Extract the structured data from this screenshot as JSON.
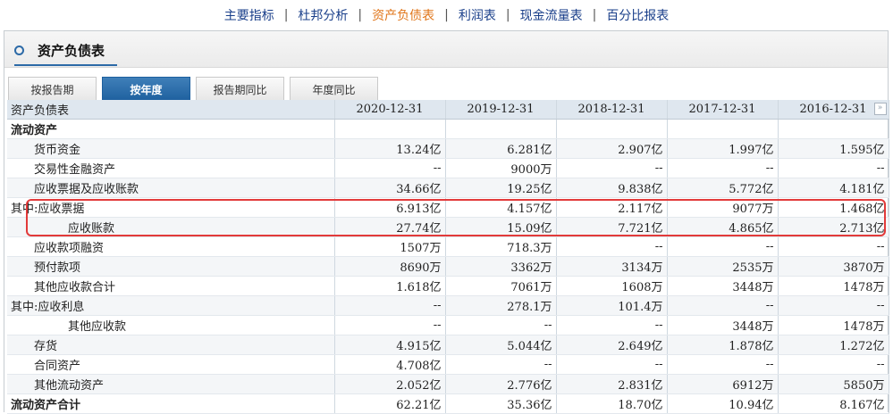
{
  "topnav": {
    "items": [
      {
        "label": "主要指标",
        "active": false
      },
      {
        "label": "杜邦分析",
        "active": false
      },
      {
        "label": "资产负债表",
        "active": true
      },
      {
        "label": "利润表",
        "active": false
      },
      {
        "label": "现金流量表",
        "active": false
      },
      {
        "label": "百分比报表",
        "active": false
      }
    ],
    "separator": "|",
    "active_color": "#e0761b",
    "link_color": "#1a3f8a"
  },
  "section": {
    "title": "资产负债表",
    "icon": "circle-icon"
  },
  "tabs": [
    {
      "label": "按报告期",
      "active": false
    },
    {
      "label": "按年度",
      "active": true
    },
    {
      "label": "报告期同比",
      "active": false
    },
    {
      "label": "年度同比",
      "active": false
    }
  ],
  "table": {
    "header_label": "资产负债表",
    "columns": [
      "2020-12-31",
      "2019-12-31",
      "2018-12-31",
      "2017-12-31",
      "2016-12-31"
    ],
    "more_icon": "double-chevron-right-icon",
    "rows": [
      {
        "label": "流动资产",
        "values": [
          "",
          "",
          "",
          "",
          ""
        ]
      },
      {
        "label": "货币资金",
        "values": [
          "13.24亿",
          "6.281亿",
          "2.907亿",
          "1.997亿",
          "1.595亿"
        ]
      },
      {
        "label": "交易性金融资产",
        "values": [
          "--",
          "9000万",
          "--",
          "--",
          "--"
        ]
      },
      {
        "label": "应收票据及应收账款",
        "values": [
          "34.66亿",
          "19.25亿",
          "9.838亿",
          "5.772亿",
          "4.181亿"
        ]
      },
      {
        "label": "其中:应收票据",
        "values": [
          "6.913亿",
          "4.157亿",
          "2.117亿",
          "9077万",
          "1.468亿"
        ]
      },
      {
        "label": "应收账款",
        "values": [
          "27.74亿",
          "15.09亿",
          "7.721亿",
          "4.865亿",
          "2.713亿"
        ]
      },
      {
        "label": "应收款项融资",
        "values": [
          "1507万",
          "718.3万",
          "--",
          "--",
          "--"
        ]
      },
      {
        "label": "预付款项",
        "values": [
          "8690万",
          "3362万",
          "3134万",
          "2535万",
          "3870万"
        ]
      },
      {
        "label": "其他应收款合计",
        "values": [
          "1.618亿",
          "7061万",
          "1608万",
          "3448万",
          "1478万"
        ]
      },
      {
        "label": "其中:应收利息",
        "values": [
          "--",
          "278.1万",
          "101.4万",
          "--",
          "--"
        ]
      },
      {
        "label": "其他应收款",
        "values": [
          "--",
          "--",
          "--",
          "3448万",
          "1478万"
        ]
      },
      {
        "label": "存货",
        "values": [
          "4.915亿",
          "5.044亿",
          "2.649亿",
          "1.878亿",
          "1.272亿"
        ]
      },
      {
        "label": "合同资产",
        "values": [
          "4.708亿",
          "--",
          "--",
          "--",
          "--"
        ]
      },
      {
        "label": "其他流动资产",
        "values": [
          "2.052亿",
          "2.776亿",
          "2.831亿",
          "6912万",
          "5850万"
        ]
      },
      {
        "label": "流动资产合计",
        "values": [
          "62.21亿",
          "35.36亿",
          "18.70亿",
          "10.94亿",
          "8.167亿"
        ]
      }
    ]
  },
  "highlight_color": "#e23a3a"
}
